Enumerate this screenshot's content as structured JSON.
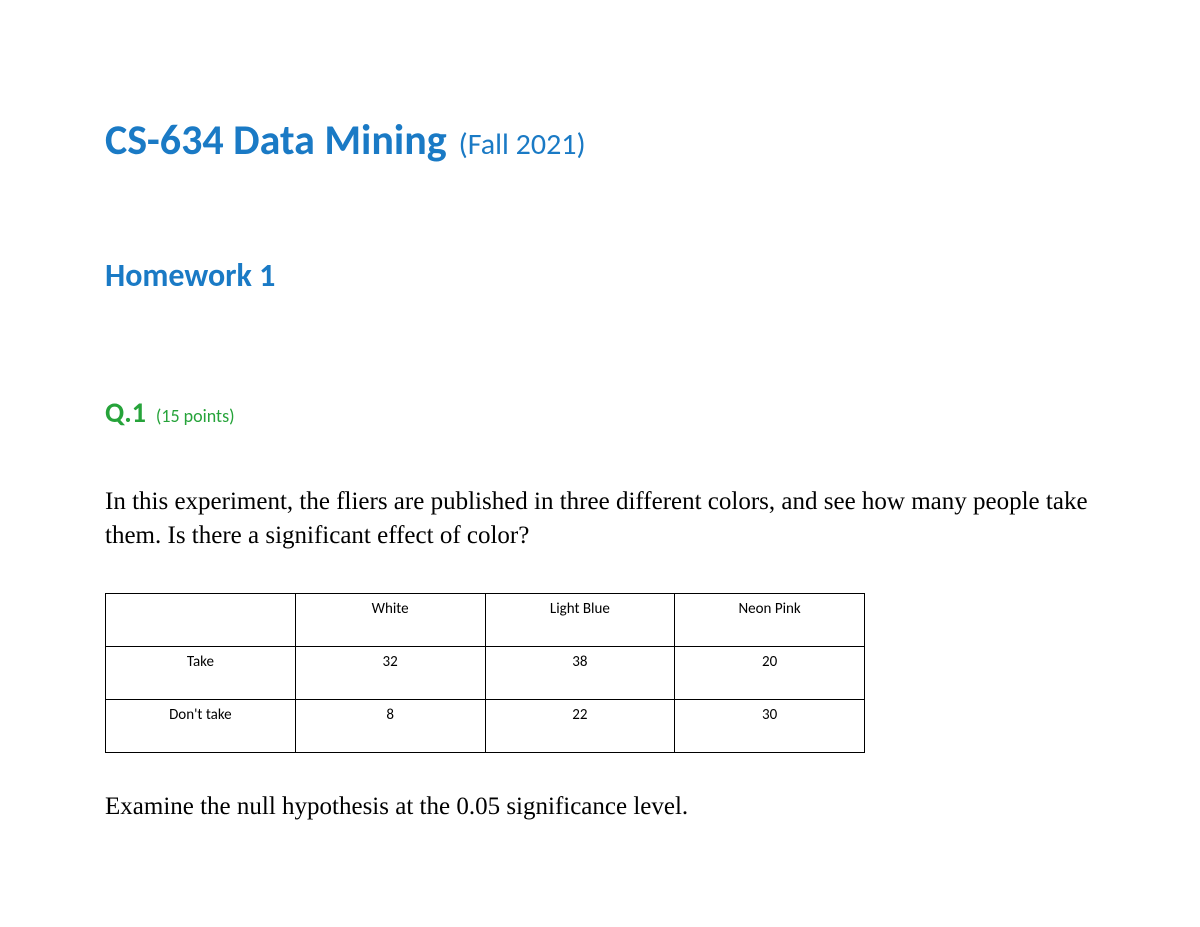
{
  "header": {
    "course_title": "CS-634 Data Mining",
    "course_term": "(Fall 2021)"
  },
  "homework": {
    "title": "Homework 1"
  },
  "question": {
    "number": "Q.1",
    "points": "(15 points)",
    "text": "In this experiment, the fliers are published in three different colors, and see how many people take them.   Is there a significant effect of color?",
    "followup": "Examine the null hypothesis at the 0.05 significance level."
  },
  "table": {
    "columns": [
      "",
      "White",
      "Light Blue",
      "Neon Pink"
    ],
    "rows": [
      {
        "label": "Take",
        "values": [
          "32",
          "38",
          "20"
        ]
      },
      {
        "label": "Don't take",
        "values": [
          "8",
          "22",
          "30"
        ]
      }
    ]
  }
}
